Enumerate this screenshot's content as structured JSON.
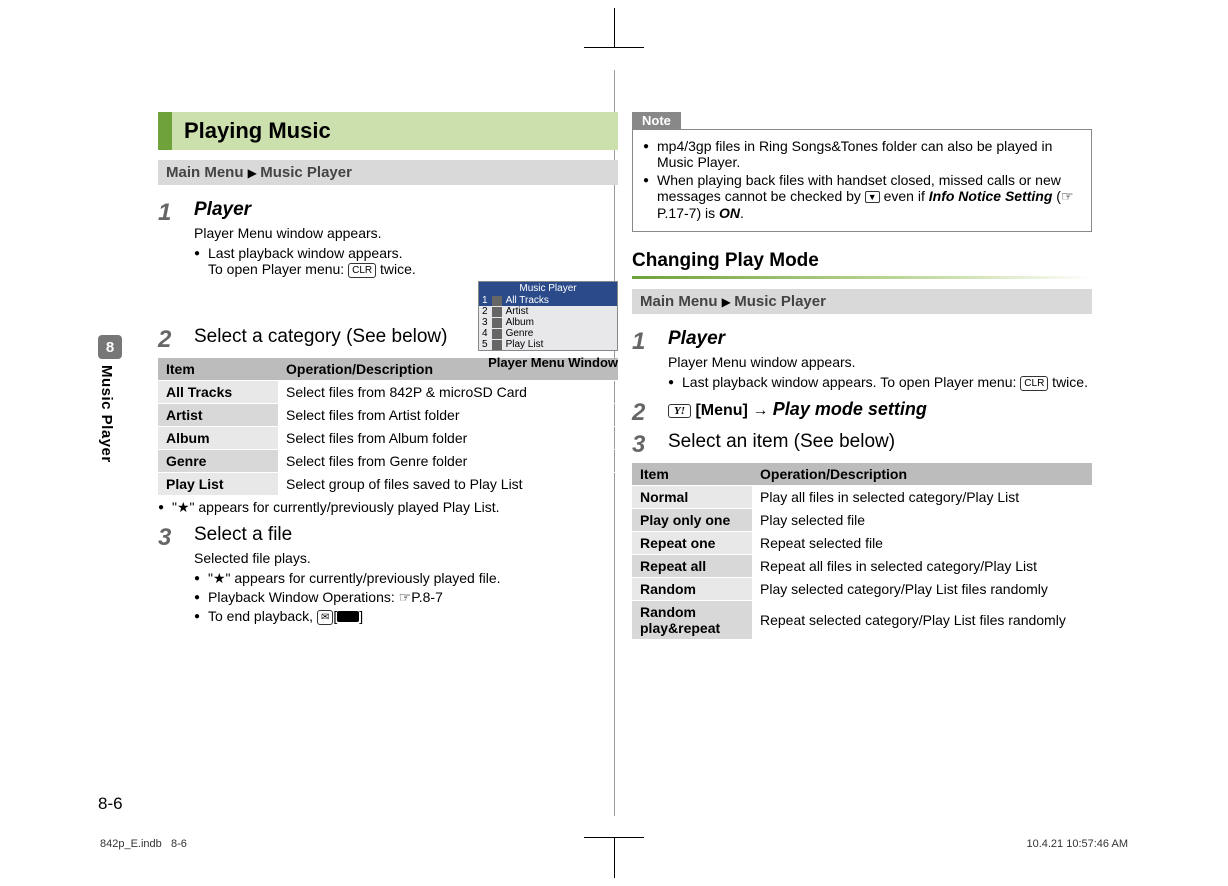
{
  "sidebar": {
    "chapter": "8",
    "label": "Music Player"
  },
  "left": {
    "section_title": "Playing Music",
    "menu_prefix": "Main Menu",
    "menu_item": "Music Player",
    "step1": {
      "num": "1",
      "title": "Player",
      "line1": "Player Menu window appears.",
      "bullet1a": "Last playback window appears.",
      "bullet1b_a": "To open Player menu: ",
      "bullet1b_key": "CLR",
      "bullet1b_b": " twice."
    },
    "figure": {
      "title": "Music Player",
      "items": [
        {
          "n": "1",
          "label": "All Tracks"
        },
        {
          "n": "2",
          "label": "Artist"
        },
        {
          "n": "3",
          "label": "Album"
        },
        {
          "n": "4",
          "label": "Genre"
        },
        {
          "n": "5",
          "label": "Play List"
        }
      ],
      "caption": "Player Menu Window"
    },
    "step2": {
      "num": "2",
      "title": "Select a category (See below)"
    },
    "table1_head": {
      "item": "Item",
      "desc": "Operation/Description"
    },
    "table1_rows": [
      {
        "item": "All Tracks",
        "desc": "Select files from 842P & microSD Card"
      },
      {
        "item": "Artist",
        "desc": "Select files from Artist folder"
      },
      {
        "item": "Album",
        "desc": "Select files from Album folder"
      },
      {
        "item": "Genre",
        "desc": "Select files from Genre folder"
      },
      {
        "item": "Play List",
        "desc": "Select group of files saved to Play List"
      }
    ],
    "after_table_bullet": "\"★\" appears for currently/previously played Play List.",
    "step3": {
      "num": "3",
      "title": "Select a file",
      "line1": "Selected file plays.",
      "b1": "\"★\" appears for currently/previously played file.",
      "b2a": "Playback Window Operations: ",
      "b2b": "P.8-7",
      "b3a": "To end playback, ",
      "b3key": "✉",
      "b3b": "["
    }
  },
  "right": {
    "note_label": "Note",
    "note1": "mp4/3gp files in Ring Songs&Tones folder can also be played in Music Player.",
    "note2a": "When playing back files with handset closed, missed calls or new messages cannot be checked by ",
    "note2b": " even if ",
    "note2c": "Info Notice Setting",
    "note2d": " (",
    "note2e": "P.17-7) is ",
    "note2f": "ON",
    "note2g": ".",
    "sub_heading": "Changing Play Mode",
    "menu_prefix": "Main Menu",
    "menu_item": "Music Player",
    "step1": {
      "num": "1",
      "title": "Player",
      "line1": "Player Menu window appears.",
      "bullet_a": "Last playback window appears. To open Player menu: ",
      "bullet_key": "CLR",
      "bullet_b": " twice."
    },
    "step2": {
      "num": "2",
      "ykey": "Y!",
      "menu": "[Menu]",
      "arrow": "→",
      "action": "Play mode setting"
    },
    "step3": {
      "num": "3",
      "title": "Select an item (See below)"
    },
    "table2_head": {
      "item": "Item",
      "desc": "Operation/Description"
    },
    "table2_rows": [
      {
        "item": "Normal",
        "desc": "Play all files in selected category/Play List"
      },
      {
        "item": "Play only one",
        "desc": "Play selected file"
      },
      {
        "item": "Repeat one",
        "desc": "Repeat selected file"
      },
      {
        "item": "Repeat all",
        "desc": "Repeat all files in selected category/Play List"
      },
      {
        "item": "Random",
        "desc": "Play selected category/Play List files randomly"
      },
      {
        "item": "Random play&repeat",
        "desc": "Repeat selected category/Play List files randomly"
      }
    ]
  },
  "pagenum": "8-6",
  "footer": {
    "left_a": "842p_E.indb",
    "left_b": "8-6",
    "right": "10.4.21   10:57:46 AM"
  }
}
